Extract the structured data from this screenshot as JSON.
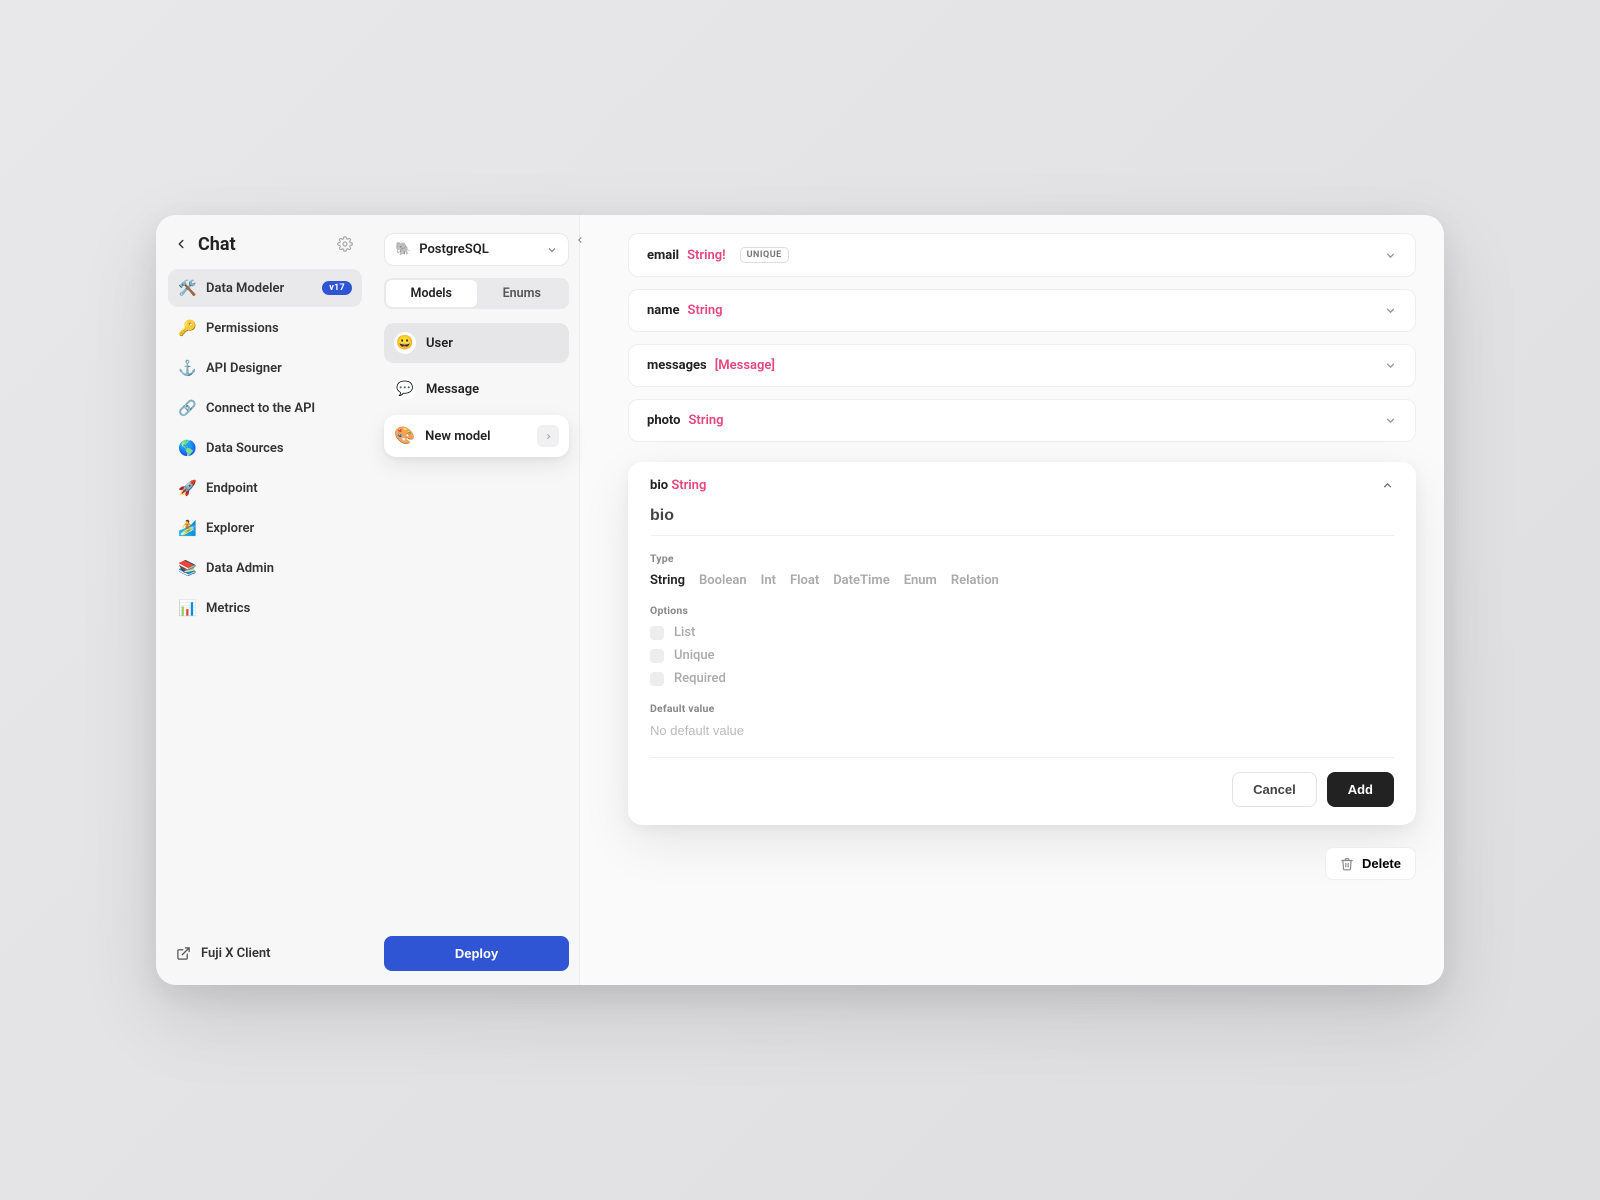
{
  "header": {
    "title": "Chat"
  },
  "sidebar": {
    "items": [
      {
        "label": "Data Modeler",
        "icon": "🛠️",
        "badge": "v17",
        "active": true,
        "colorful": false
      },
      {
        "label": "Permissions",
        "icon": "🔑",
        "colorful": false
      },
      {
        "label": "API Designer",
        "icon": "⚓",
        "colorful": false
      },
      {
        "label": "Connect to the API",
        "icon": "🔗",
        "colorful": false
      },
      {
        "label": "Data Sources",
        "icon": "🌎",
        "colorful": true
      },
      {
        "label": "Endpoint",
        "icon": "🚀",
        "colorful": true
      },
      {
        "label": "Explorer",
        "icon": "🏄",
        "colorful": true
      },
      {
        "label": "Data Admin",
        "icon": "📚",
        "colorful": true
      },
      {
        "label": "Metrics",
        "icon": "📊",
        "colorful": true
      }
    ],
    "footer_label": "Fuji X Client"
  },
  "col2": {
    "db_icon": "🐘",
    "db_name": "PostgreSQL",
    "tabs": [
      {
        "label": "Models",
        "active": true
      },
      {
        "label": "Enums",
        "active": false
      }
    ],
    "models": [
      {
        "icon": "😀",
        "label": "User",
        "selected": true
      },
      {
        "icon": "💬",
        "label": "Message",
        "selected": false
      }
    ],
    "new_model_icon": "🎨",
    "new_model_label": "New model",
    "deploy_label": "Deploy"
  },
  "fields": [
    {
      "name": "email",
      "type": "String!",
      "badge": "UNIQUE"
    },
    {
      "name": "name",
      "type": "String"
    },
    {
      "name": "messages",
      "type": "[Message]"
    },
    {
      "name": "photo",
      "type": "String"
    }
  ],
  "editing": {
    "header_name": "bio",
    "header_type": "String",
    "name_value": "bio",
    "type_label": "Type",
    "types": [
      {
        "label": "String",
        "selected": true
      },
      {
        "label": "Boolean"
      },
      {
        "label": "Int"
      },
      {
        "label": "Float"
      },
      {
        "label": "DateTime"
      },
      {
        "label": "Enum"
      },
      {
        "label": "Relation"
      }
    ],
    "options_label": "Options",
    "options": [
      {
        "label": "List"
      },
      {
        "label": "Unique"
      },
      {
        "label": "Required"
      }
    ],
    "default_label": "Default value",
    "default_placeholder": "No default value",
    "cancel_label": "Cancel",
    "add_label": "Add"
  },
  "delete_label": "Delete"
}
